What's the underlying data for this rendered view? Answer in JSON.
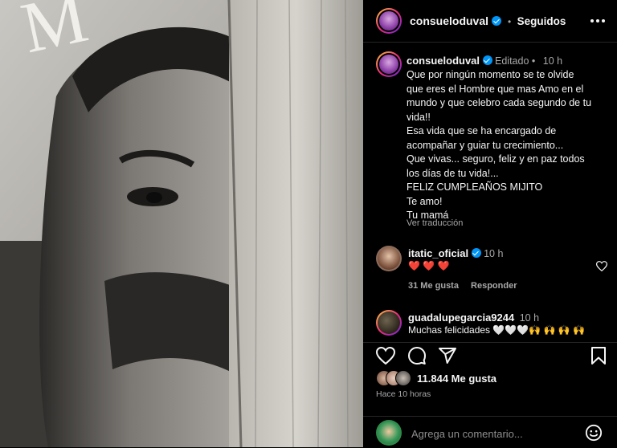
{
  "header": {
    "username": "consueloduval",
    "separator": "•",
    "follow_status": "Seguidos",
    "more_icon": "more-horizontal-icon"
  },
  "caption": {
    "username": "consueloduval",
    "edited": "Editado",
    "separator": "•",
    "time": "10 h",
    "lines": [
      "Que por ningún momento se te olvide",
      "que eres el Hombre que mas Amo en el",
      "mundo y que celebro cada segundo de tu",
      "vida!!",
      "Esa vida que se ha encargado de",
      "acompañar y guiar tu crecimiento...",
      "Que vivas... seguro, feliz y en paz todos",
      "los días de tu vida!...",
      "FELIZ CUMPLEAÑOS MIJITO",
      "Te amo!",
      "Tu mamá"
    ],
    "translate": "Ver traducción"
  },
  "comments": [
    {
      "username": "itatic_oficial",
      "time": "10 h",
      "text": "❤️ ❤️ ❤️",
      "likes": "31 Me gusta",
      "reply": "Responder"
    },
    {
      "username": "guadalupegarcia9244",
      "time": "10 h",
      "text": "Muchas felicidades 🤍🤍🤍🙌 🙌 🙌 🙌"
    }
  ],
  "actions": {
    "like_icon": "heart-outline-icon",
    "comment_icon": "comment-icon",
    "share_icon": "share-icon",
    "save_icon": "bookmark-icon"
  },
  "likes": {
    "count": "11.844 Me gusta",
    "time_ago": "Hace 10 horas"
  },
  "footer": {
    "comment_placeholder": "Agrega un comentario...",
    "emoji_icon": "emoji-icon"
  },
  "photo": {
    "overlay_text": "M"
  }
}
